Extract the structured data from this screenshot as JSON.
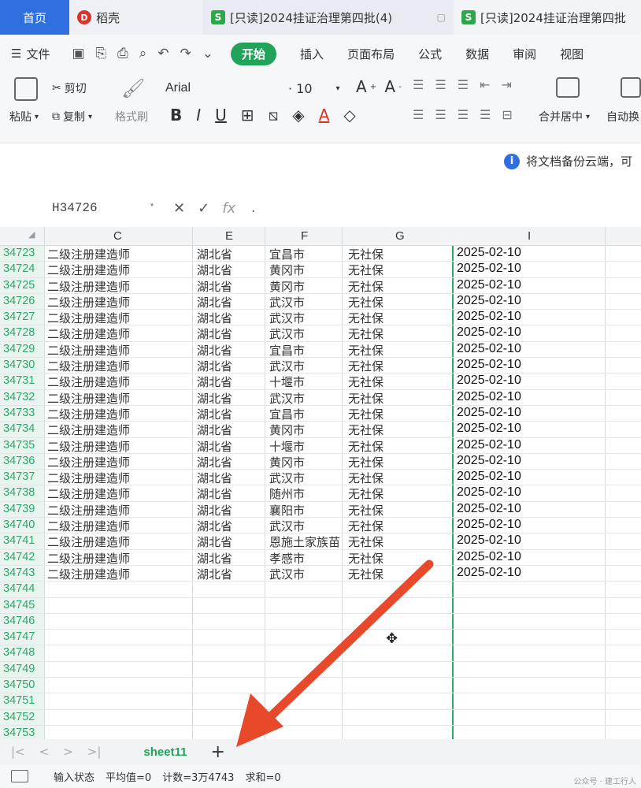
{
  "tabs": [
    {
      "label": "首页"
    },
    {
      "label": "稻壳"
    },
    {
      "label": "[只读]2024挂证治理第四批(4)"
    },
    {
      "label": "[只读]2024挂证治理第四批"
    }
  ],
  "menu": {
    "file": "文件",
    "ribbon_tabs": [
      "开始",
      "插入",
      "页面布局",
      "公式",
      "数据",
      "审阅",
      "视图"
    ]
  },
  "ribbon": {
    "paste": "粘贴",
    "cut": "剪切",
    "copy": "复制",
    "format_painter": "格式刷",
    "font": "Arial",
    "size": "10",
    "merge": "合并居中",
    "autowrap": "自动换"
  },
  "notice": "将文档备份云端，可",
  "formula": {
    "cell_ref": "H34726",
    "value": "."
  },
  "columns": [
    "C",
    "E",
    "F",
    "G",
    "I"
  ],
  "rows": [
    {
      "n": "34723",
      "c": "二级注册建造师",
      "e": "湖北省",
      "f": "宜昌市",
      "g": "无社保",
      "i": "2025-02-10"
    },
    {
      "n": "34724",
      "c": "二级注册建造师",
      "e": "湖北省",
      "f": "黄冈市",
      "g": "无社保",
      "i": "2025-02-10"
    },
    {
      "n": "34725",
      "c": "二级注册建造师",
      "e": "湖北省",
      "f": "黄冈市",
      "g": "无社保",
      "i": "2025-02-10"
    },
    {
      "n": "34726",
      "c": "二级注册建造师",
      "e": "湖北省",
      "f": "武汉市",
      "g": "无社保",
      "i": "2025-02-10"
    },
    {
      "n": "34727",
      "c": "二级注册建造师",
      "e": "湖北省",
      "f": "武汉市",
      "g": "无社保",
      "i": "2025-02-10"
    },
    {
      "n": "34728",
      "c": "二级注册建造师",
      "e": "湖北省",
      "f": "武汉市",
      "g": "无社保",
      "i": "2025-02-10"
    },
    {
      "n": "34729",
      "c": "二级注册建造师",
      "e": "湖北省",
      "f": "宜昌市",
      "g": "无社保",
      "i": "2025-02-10"
    },
    {
      "n": "34730",
      "c": "二级注册建造师",
      "e": "湖北省",
      "f": "武汉市",
      "g": "无社保",
      "i": "2025-02-10"
    },
    {
      "n": "34731",
      "c": "二级注册建造师",
      "e": "湖北省",
      "f": "十堰市",
      "g": "无社保",
      "i": "2025-02-10"
    },
    {
      "n": "34732",
      "c": "二级注册建造师",
      "e": "湖北省",
      "f": "武汉市",
      "g": "无社保",
      "i": "2025-02-10"
    },
    {
      "n": "34733",
      "c": "二级注册建造师",
      "e": "湖北省",
      "f": "宜昌市",
      "g": "无社保",
      "i": "2025-02-10"
    },
    {
      "n": "34734",
      "c": "二级注册建造师",
      "e": "湖北省",
      "f": "黄冈市",
      "g": "无社保",
      "i": "2025-02-10"
    },
    {
      "n": "34735",
      "c": "二级注册建造师",
      "e": "湖北省",
      "f": "十堰市",
      "g": "无社保",
      "i": "2025-02-10"
    },
    {
      "n": "34736",
      "c": "二级注册建造师",
      "e": "湖北省",
      "f": "黄冈市",
      "g": "无社保",
      "i": "2025-02-10"
    },
    {
      "n": "34737",
      "c": "二级注册建造师",
      "e": "湖北省",
      "f": "武汉市",
      "g": "无社保",
      "i": "2025-02-10"
    },
    {
      "n": "34738",
      "c": "二级注册建造师",
      "e": "湖北省",
      "f": "随州市",
      "g": "无社保",
      "i": "2025-02-10"
    },
    {
      "n": "34739",
      "c": "二级注册建造师",
      "e": "湖北省",
      "f": "襄阳市",
      "g": "无社保",
      "i": "2025-02-10"
    },
    {
      "n": "34740",
      "c": "二级注册建造师",
      "e": "湖北省",
      "f": "武汉市",
      "g": "无社保",
      "i": "2025-02-10"
    },
    {
      "n": "34741",
      "c": "二级注册建造师",
      "e": "湖北省",
      "f": "恩施土家族苗",
      "g": "无社保",
      "i": "2025-02-10"
    },
    {
      "n": "34742",
      "c": "二级注册建造师",
      "e": "湖北省",
      "f": "孝感市",
      "g": "无社保",
      "i": "2025-02-10"
    },
    {
      "n": "34743",
      "c": "二级注册建造师",
      "e": "湖北省",
      "f": "武汉市",
      "g": "无社保",
      "i": "2025-02-10"
    },
    {
      "n": "34744",
      "c": "",
      "e": "",
      "f": "",
      "g": "",
      "i": ""
    },
    {
      "n": "34745",
      "c": "",
      "e": "",
      "f": "",
      "g": "",
      "i": ""
    },
    {
      "n": "34746",
      "c": "",
      "e": "",
      "f": "",
      "g": "",
      "i": ""
    },
    {
      "n": "34747",
      "c": "",
      "e": "",
      "f": "",
      "g": "",
      "i": ""
    },
    {
      "n": "34748",
      "c": "",
      "e": "",
      "f": "",
      "g": "",
      "i": ""
    },
    {
      "n": "34749",
      "c": "",
      "e": "",
      "f": "",
      "g": "",
      "i": ""
    },
    {
      "n": "34750",
      "c": "",
      "e": "",
      "f": "",
      "g": "",
      "i": ""
    },
    {
      "n": "34751",
      "c": "",
      "e": "",
      "f": "",
      "g": "",
      "i": ""
    },
    {
      "n": "34752",
      "c": "",
      "e": "",
      "f": "",
      "g": "",
      "i": ""
    },
    {
      "n": "34753",
      "c": "",
      "e": "",
      "f": "",
      "g": "",
      "i": ""
    }
  ],
  "sheet": {
    "name": "sheet11",
    "add": "+"
  },
  "status": {
    "mode": "输入状态",
    "avg": "平均值=0",
    "count": "计数=3万4743",
    "sum": "求和=0"
  },
  "watermark": "公众号 · 建工行人",
  "colors": {
    "accent": "#21a35a",
    "home_tab": "#2f6fe0",
    "arrow": "#e8492b"
  }
}
